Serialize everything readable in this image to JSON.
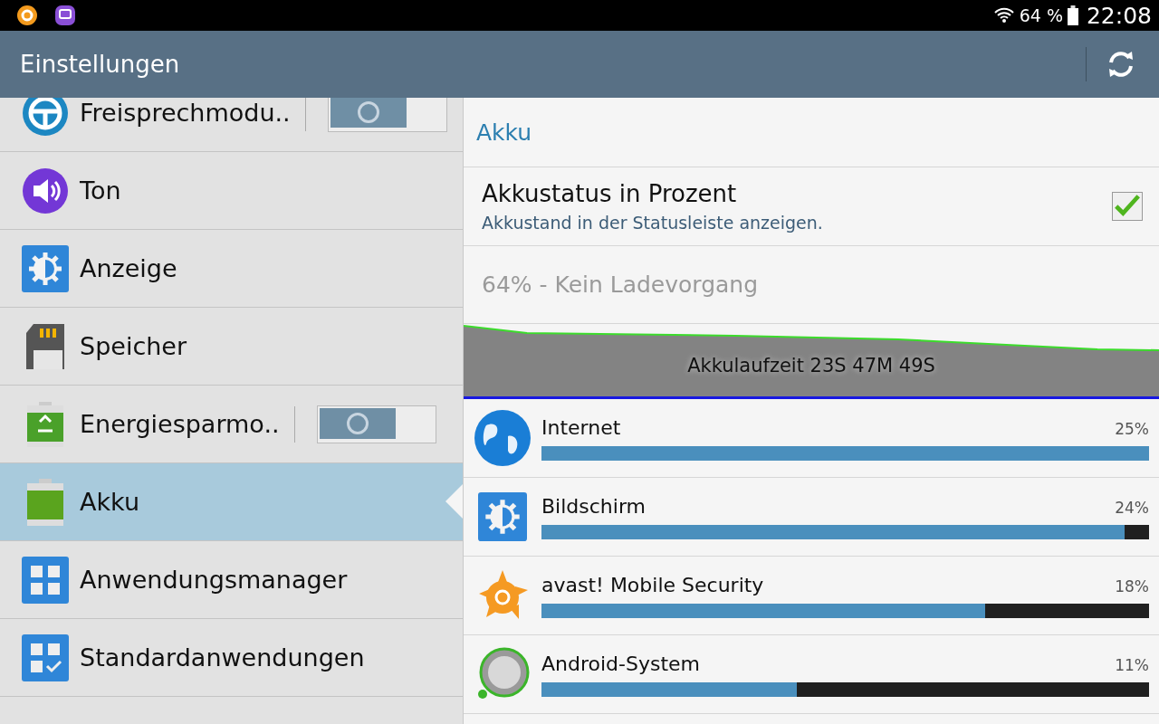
{
  "status_bar": {
    "battery_text": "64 %",
    "time": "22:08"
  },
  "action_bar": {
    "title": "Einstellungen"
  },
  "sidebar": {
    "items": [
      {
        "label": "Freisprechmodu..",
        "kind": "toggle",
        "on": false,
        "selected": false
      },
      {
        "label": "Ton",
        "kind": "plain",
        "selected": false
      },
      {
        "label": "Anzeige",
        "kind": "plain",
        "selected": false
      },
      {
        "label": "Speicher",
        "kind": "plain",
        "selected": false
      },
      {
        "label": "Energiesparmo..",
        "kind": "toggle",
        "on": false,
        "selected": false
      },
      {
        "label": "Akku",
        "kind": "plain",
        "selected": true
      },
      {
        "label": "Anwendungsmanager",
        "kind": "plain",
        "selected": false
      },
      {
        "label": "Standardanwendungen",
        "kind": "plain",
        "selected": false
      }
    ]
  },
  "detail": {
    "heading": "Akku",
    "setting": {
      "title": "Akkustatus in Prozent",
      "subtitle": "Akkustand in der Statusleiste anzeigen.",
      "checked": true
    },
    "charge_status": "64% - Kein Ladevorgang",
    "graph_label": "Akkulaufzeit 23S 47M 49S",
    "apps": [
      {
        "name": "Internet",
        "percent": "25%",
        "level": 1.0
      },
      {
        "name": "Bildschirm",
        "percent": "24%",
        "level": 0.96
      },
      {
        "name": "avast! Mobile Security",
        "percent": "18%",
        "level": 0.73
      },
      {
        "name": "Android-System",
        "percent": "11%",
        "level": 0.42
      }
    ]
  }
}
